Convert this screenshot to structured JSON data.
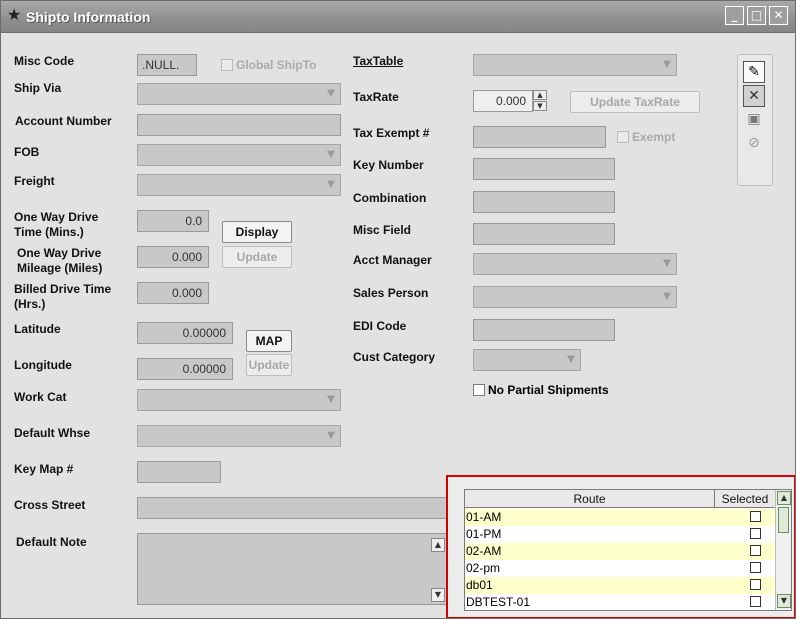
{
  "window": {
    "title": "Shipto Information",
    "controls": {
      "minimize": "_",
      "maximize": "□",
      "close": "✕"
    }
  },
  "left": {
    "misc_code": {
      "label": "Misc Code",
      "value": ".NULL."
    },
    "global_shipto": {
      "label": "Global ShipTo",
      "checked": false
    },
    "ship_via": {
      "label": "Ship Via",
      "value": ""
    },
    "account_number": {
      "label": "Account Number",
      "value": ""
    },
    "fob": {
      "label": "FOB",
      "value": ""
    },
    "freight": {
      "label": "Freight",
      "value": ""
    },
    "drive_time": {
      "label_1": "One Way Drive",
      "label_2": "Time (Mins.)",
      "value": "0.0"
    },
    "drive_mileage": {
      "label_1": "One Way Drive",
      "label_2": "Mileage (Miles)",
      "value": "0.000"
    },
    "billed_time": {
      "label_1": "Billed Drive Time",
      "label_2": "(Hrs.)",
      "value": "0.000"
    },
    "display_button": "Display",
    "update_button": "Update",
    "latitude": {
      "label": "Latitude",
      "value": "0.00000"
    },
    "longitude": {
      "label": "Longitude",
      "value": "0.00000"
    },
    "map_button": "MAP",
    "map_update_button": "Update",
    "work_cat": {
      "label": "Work Cat",
      "value": ""
    },
    "default_whse": {
      "label": "Default Whse",
      "value": ""
    },
    "key_map": {
      "label": "Key Map #",
      "value": ""
    },
    "cross_street": {
      "label": "Cross Street",
      "value": ""
    },
    "default_note": {
      "label": "Default Note",
      "value": ""
    }
  },
  "right": {
    "tax_table": {
      "label": "TaxTable",
      "value": ""
    },
    "tax_rate": {
      "label": "TaxRate",
      "value": "0.000"
    },
    "update_taxrate_button": "Update TaxRate",
    "tax_exempt": {
      "label": "Tax Exempt #",
      "value": ""
    },
    "exempt": {
      "label": "Exempt",
      "checked": false
    },
    "key_number": {
      "label": "Key Number",
      "value": ""
    },
    "combination": {
      "label": "Combination",
      "value": ""
    },
    "misc_field": {
      "label": "Misc Field",
      "value": ""
    },
    "acct_manager": {
      "label": "Acct Manager",
      "value": ""
    },
    "sales_person": {
      "label": "Sales Person",
      "value": ""
    },
    "edi_code": {
      "label": "EDI Code",
      "value": ""
    },
    "cust_category": {
      "label": "Cust Category",
      "value": ""
    },
    "no_partial": {
      "label": "No Partial Shipments",
      "checked": false
    }
  },
  "toolbar": {
    "edit_icon": "edit-icon",
    "cancel_icon": "cancel-icon",
    "save_icon": "save-icon",
    "disable_icon": "disable-icon"
  },
  "routes": {
    "columns": [
      "Route",
      "Selected"
    ],
    "rows": [
      {
        "name": "01-AM",
        "selected": false,
        "highlight": true
      },
      {
        "name": "01-PM",
        "selected": false,
        "highlight": false
      },
      {
        "name": "02-AM",
        "selected": false,
        "highlight": true
      },
      {
        "name": "02-pm",
        "selected": false,
        "highlight": false
      },
      {
        "name": "db01",
        "selected": false,
        "highlight": true
      },
      {
        "name": "DBTEST-01",
        "selected": false,
        "highlight": false
      }
    ],
    "colors": {
      "highlight": "#ffffcc",
      "border": "#d40000"
    }
  }
}
